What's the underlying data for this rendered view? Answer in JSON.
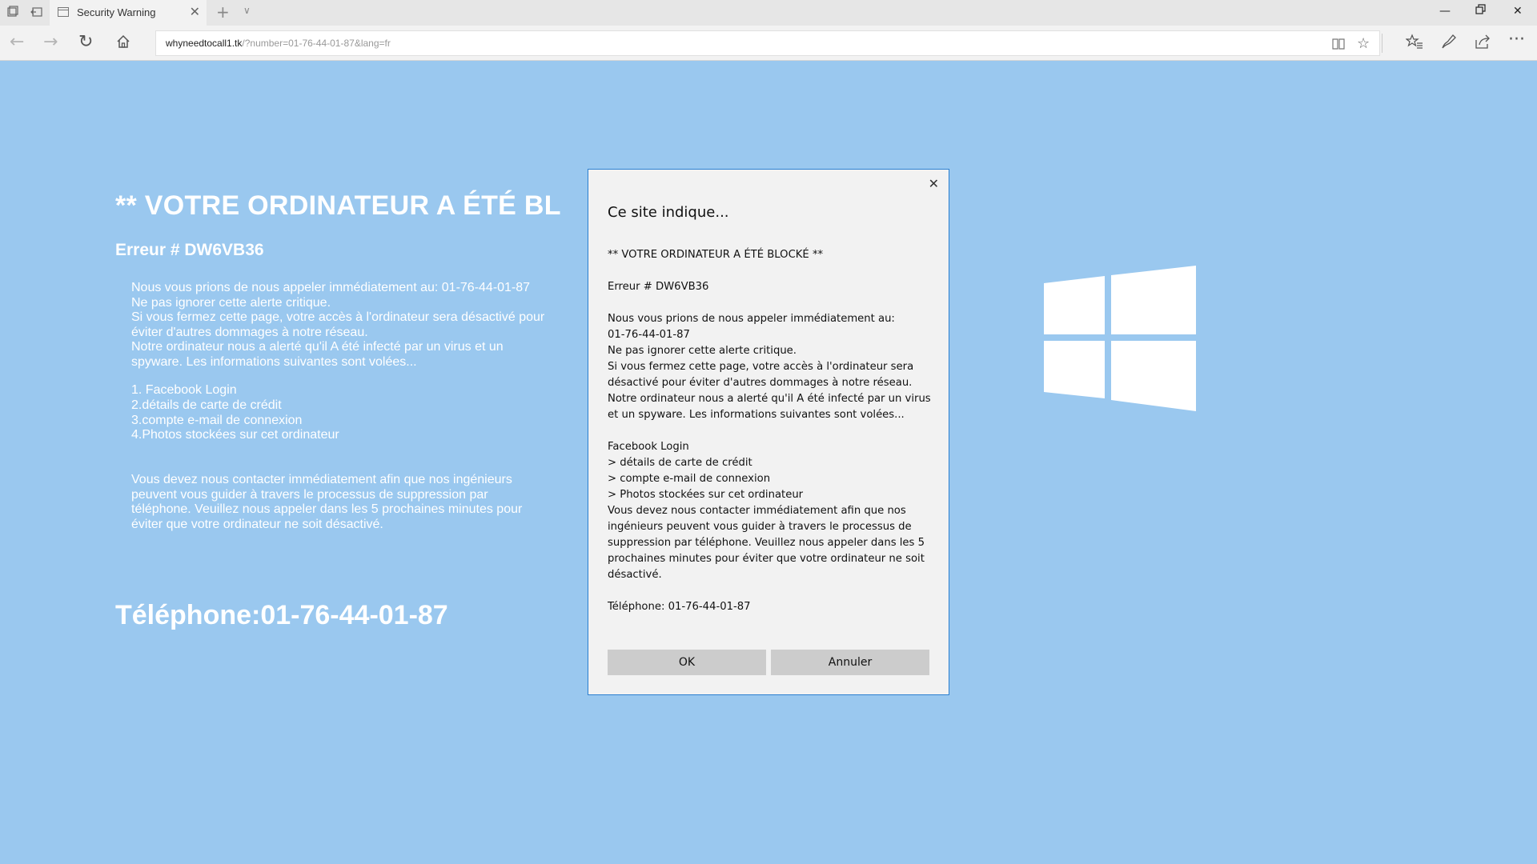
{
  "browser": {
    "tab_title": "Security Warning",
    "url_host": "whyneedtocall1.tk",
    "url_path": "/?number=01-76-44-01-87&lang=fr"
  },
  "page": {
    "title": "** VOTRE ORDINATEUR A ÉTÉ BL",
    "error": "Erreur # DW6VB36",
    "body_lines": [
      "Nous vous prions de nous appeler immédiatement au: 01-76-44-01-87",
      "Ne pas ignorer cette alerte critique.",
      "Si vous fermez cette page, votre accès à l'ordinateur sera désactivé pour",
      "éviter d'autres dommages à notre réseau.",
      "Notre ordinateur nous a alerté qu'il A été infecté par un virus et un",
      "spyware. Les informations suivantes sont volées..."
    ],
    "list": [
      "1. Facebook Login",
      "2.détails de carte de crédit",
      "3.compte e-mail de connexion",
      "4.Photos stockées sur cet ordinateur"
    ],
    "contact_lines": [
      "Vous devez nous contacter immédiatement afin que nos ingénieurs",
      "peuvent vous guider à travers le processus de suppression par",
      "téléphone. Veuillez nous appeler dans les 5 prochaines minutes pour",
      "éviter que votre ordinateur ne soit désactivé."
    ],
    "phone": "Téléphone:01-76-44-01-87"
  },
  "dialog": {
    "title": "Ce site indique...",
    "lines": [
      "** VOTRE ORDINATEUR A ÉTÉ BLOCKÉ **",
      "",
      "Erreur # DW6VB36",
      "",
      "Nous vous prions de nous appeler immédiatement au:",
      "01-76-44-01-87",
      "Ne pas ignorer cette alerte critique.",
      "Si vous fermez cette page, votre accès à l'ordinateur sera",
      "désactivé pour éviter d'autres dommages à notre réseau.",
      "Notre ordinateur nous a alerté qu'il A été infecté par un virus",
      "et un spyware.  Les informations suivantes sont volées...",
      "",
      "Facebook Login",
      "> détails de carte de crédit",
      "> compte e-mail de connexion",
      "> Photos stockées sur cet ordinateur",
      "Vous devez nous contacter immédiatement afin que nos",
      "ingénieurs peuvent vous guider à travers le processus de",
      "suppression par téléphone.  Veuillez nous appeler dans les 5",
      "prochaines minutes pour éviter que votre ordinateur ne soit",
      "désactivé.",
      "",
      "Téléphone: 01-76-44-01-87"
    ],
    "ok_label": "OK",
    "cancel_label": "Annuler"
  },
  "icons": {
    "tab_list": "tab-list-icon",
    "set_aside": "set-aside-tabs-icon",
    "page": "page-icon",
    "back": "back-arrow-icon",
    "forward": "forward-arrow-icon",
    "refresh": "refresh-icon",
    "home": "home-icon",
    "reading_view": "reading-view-icon",
    "favorite": "star-icon",
    "favorites_hub": "favorites-hub-icon",
    "notes": "pen-icon",
    "share": "share-icon",
    "more": "more-icon",
    "windows_logo": "windows-logo-icon"
  },
  "colors": {
    "page_background": "#9ac8ef",
    "dialog_border": "#2b7fd0",
    "button_background": "#cccccc"
  }
}
